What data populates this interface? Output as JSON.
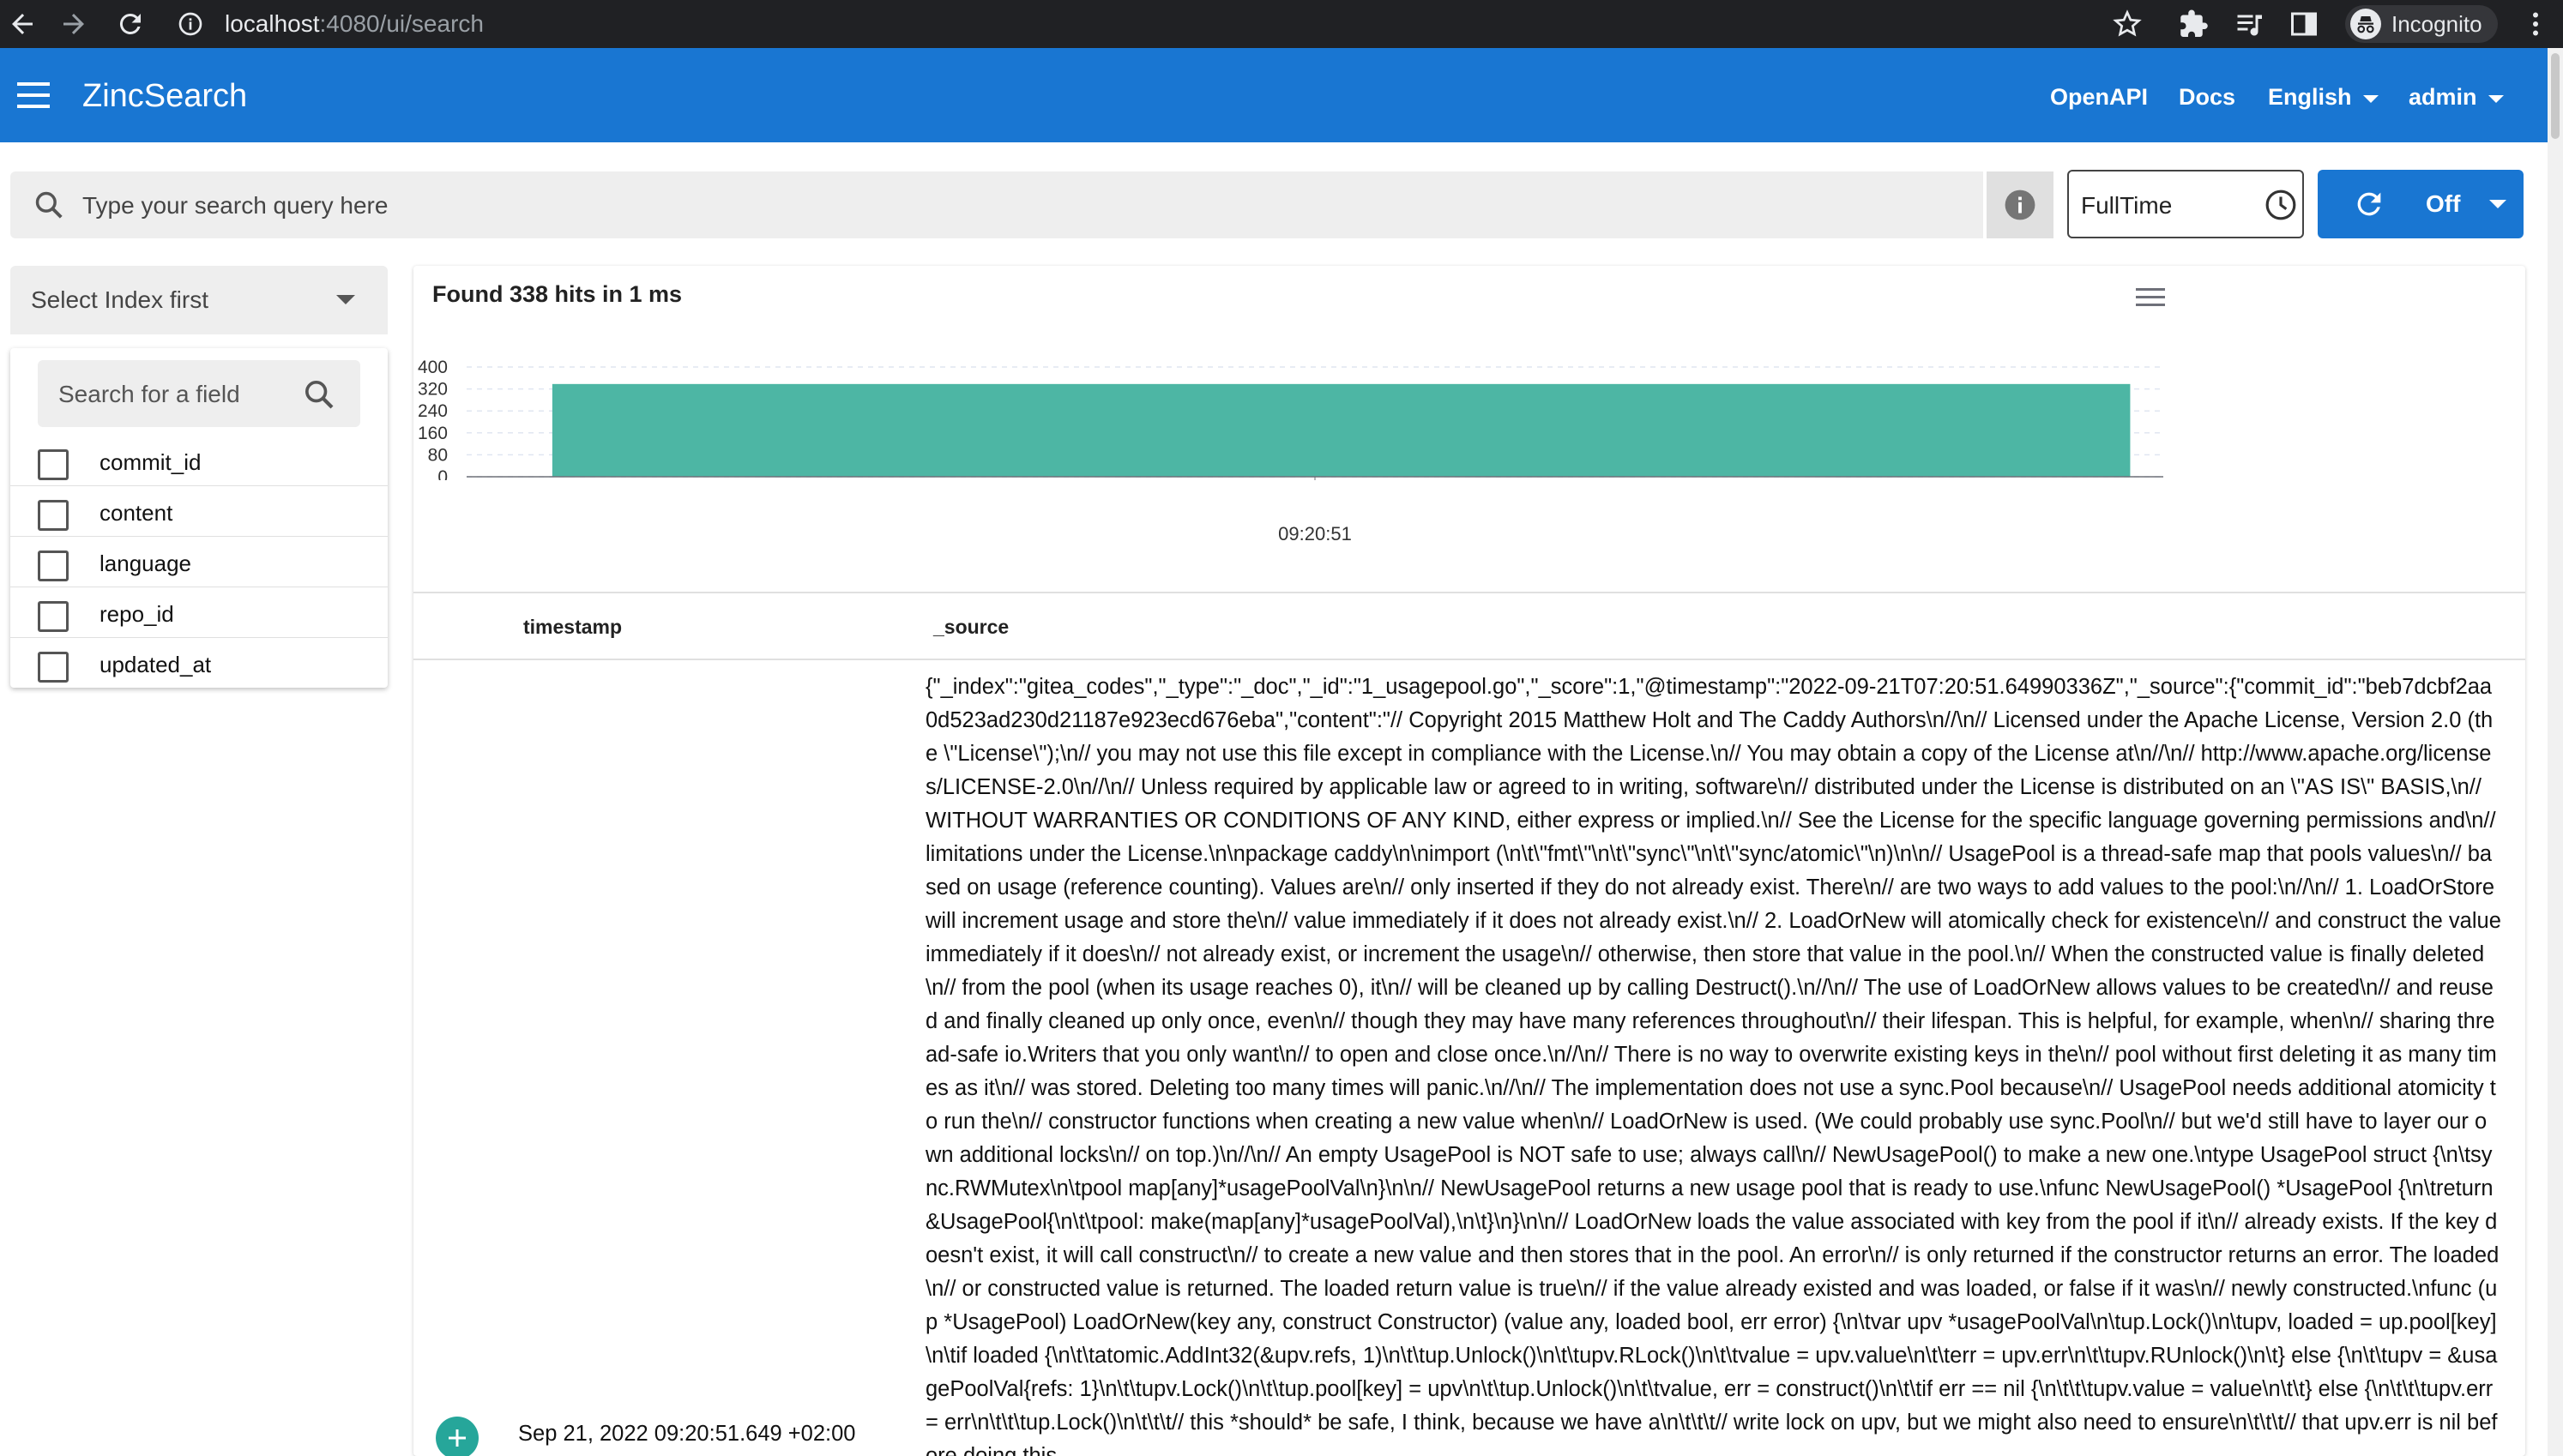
{
  "browser": {
    "url_host": "localhost",
    "url_port_path": ":4080/ui/search",
    "profile_label": "Incognito"
  },
  "header": {
    "title": "ZincSearch",
    "nav": [
      "OpenAPI",
      "Docs",
      "English",
      "admin"
    ]
  },
  "search": {
    "placeholder": "Type your search query here",
    "time_label": "FullTime",
    "refresh_label": "Off"
  },
  "sidebar": {
    "index_placeholder": "Select Index first",
    "field_search_placeholder": "Search for a field",
    "fields": [
      "commit_id",
      "content",
      "language",
      "repo_id",
      "updated_at"
    ]
  },
  "results": {
    "summary": "Found 338 hits in 1 ms",
    "columns": [
      "timestamp",
      "_source"
    ],
    "rows": [
      {
        "timestamp": "Sep 21, 2022 09:20:51.649 +02:00",
        "source": "{\"_index\":\"gitea_codes\",\"_type\":\"_doc\",\"_id\":\"1_usagepool.go\",\"_score\":1,\"@timestamp\":\"2022-09-21T07:20:51.64990336Z\",\"_source\":{\"commit_id\":\"beb7dcbf2aa0d523ad230d21187e923ecd676eba\",\"content\":\"// Copyright 2015 Matthew Holt and The Caddy Authors\\n//\\n// Licensed under the Apache License, Version 2.0 (the \\\"License\\\");\\n// you may not use this file except in compliance with the License.\\n// You may obtain a copy of the License at\\n//\\n//     http://www.apache.org/licenses/LICENSE-2.0\\n//\\n// Unless required by applicable law or agreed to in writing, software\\n// distributed under the License is distributed on an \\\"AS IS\\\" BASIS,\\n// WITHOUT WARRANTIES OR CONDITIONS OF ANY KIND, either express or implied.\\n// See the License for the specific language governing permissions and\\n// limitations under the License.\\n\\npackage caddy\\n\\nimport (\\n\\t\\\"fmt\\\"\\n\\t\\\"sync\\\"\\n\\t\\\"sync/atomic\\\"\\n)\\n\\n// UsagePool is a thread-safe map that pools values\\n// based on usage (reference counting). Values are\\n// only inserted if they do not already exist. There\\n// are two ways to add values to the pool:\\n//\\n//  1. LoadOrStore will increment usage and store the\\n//     value immediately if it does not already exist.\\n//  2. LoadOrNew will atomically check for existence\\n//     and construct the value immediately if it does\\n//     not already exist, or increment the usage\\n//     otherwise, then store that value in the pool.\\n//     When the constructed value is finally deleted\\n//     from the pool (when its usage reaches 0), it\\n//     will be cleaned up by calling Destruct().\\n//\\n// The use of LoadOrNew allows values to be created\\n// and reused and finally cleaned up only once, even\\n// though they may have many references throughout\\n// their lifespan. This is helpful, for example, when\\n// sharing thread-safe io.Writers that you only want\\n// to open and close once.\\n//\\n// There is no way to overwrite existing keys in the\\n// pool without first deleting it as many times as it\\n// was stored. Deleting too many times will panic.\\n//\\n// The implementation does not use a sync.Pool because\\n// UsagePool needs additional atomicity to run the\\n// constructor functions when creating a new value when\\n// LoadOrNew is used. (We could probably use sync.Pool\\n// but we'd still have to layer our own additional locks\\n// on top.)\\n//\\n// An empty UsagePool is NOT safe to use; always call\\n// NewUsagePool() to make a new one.\\ntype UsagePool struct {\\n\\tsync.RWMutex\\n\\tpool map[any]*usagePoolVal\\n}\\n\\n// NewUsagePool returns a new usage pool that is ready to use.\\nfunc NewUsagePool() *UsagePool {\\n\\treturn &UsagePool{\\n\\t\\tpool: make(map[any]*usagePoolVal),\\n\\t}\\n}\\n\\n// LoadOrNew loads the value associated with key from the pool if it\\n// already exists. If the key doesn't exist, it will call construct\\n// to create a new value and then stores that in the pool. An error\\n// is only returned if the constructor returns an error. The loaded\\n// or constructed value is returned. The loaded return value is true\\n// if the value already existed and was loaded, or false if it was\\n// newly constructed.\\nfunc (up *UsagePool) LoadOrNew(key any, construct Constructor) (value any, loaded bool, err error) {\\n\\tvar upv *usagePoolVal\\n\\tup.Lock()\\n\\tupv, loaded = up.pool[key]\\n\\tif loaded {\\n\\t\\tatomic.AddInt32(&upv.refs, 1)\\n\\t\\tup.Unlock()\\n\\t\\tupv.RLock()\\n\\t\\tvalue = upv.value\\n\\t\\terr = upv.err\\n\\t\\tupv.RUnlock()\\n\\t} else {\\n\\t\\tupv = &usagePoolVal{refs: 1}\\n\\t\\tupv.Lock()\\n\\t\\tup.pool[key] = upv\\n\\t\\tup.Unlock()\\n\\t\\tvalue, err = construct()\\n\\t\\tif err == nil {\\n\\t\\t\\tupv.value = value\\n\\t\\t} else {\\n\\t\\t\\tupv.err = err\\n\\t\\t\\tup.Lock()\\n\\t\\t\\t// this *should* be safe, I think, because we have a\\n\\t\\t\\t// write lock on upv, but we might also need to ensure\\n\\t\\t\\t// that upv.err is nil before doing this"
      }
    ]
  },
  "chart_data": {
    "type": "bar",
    "categories": [
      "09:20:51"
    ],
    "values": [
      338
    ],
    "yticks": [
      "400",
      "320",
      "240",
      "160",
      "80",
      "0"
    ],
    "ylim": [
      0,
      400
    ],
    "bar_color": "#4db6a4"
  },
  "colors": {
    "primary": "#1976d2",
    "accent": "#26a69a"
  }
}
